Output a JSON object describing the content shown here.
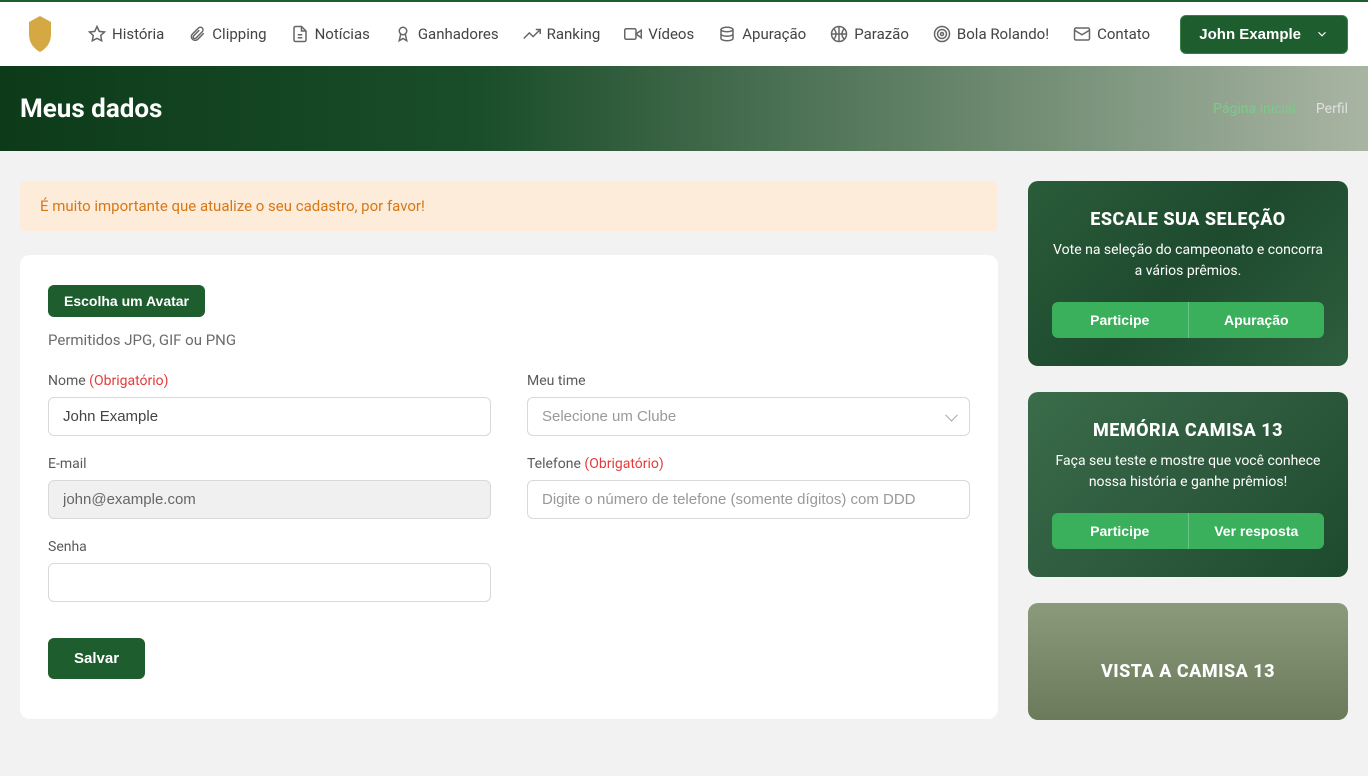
{
  "nav": {
    "items": [
      {
        "label": "História",
        "icon": "star"
      },
      {
        "label": "Clipping",
        "icon": "paperclip"
      },
      {
        "label": "Notícias",
        "icon": "file"
      },
      {
        "label": "Ganhadores",
        "icon": "award"
      },
      {
        "label": "Ranking",
        "icon": "trending"
      },
      {
        "label": "Vídeos",
        "icon": "video"
      },
      {
        "label": "Apuração",
        "icon": "layers"
      },
      {
        "label": "Parazão",
        "icon": "basketball"
      },
      {
        "label": "Bola Rolando!",
        "icon": "target"
      },
      {
        "label": "Contato",
        "icon": "mail"
      }
    ],
    "user": "John Example"
  },
  "hero": {
    "title": "Meus dados",
    "breadcrumb": [
      "Página inicial",
      "Perfil"
    ]
  },
  "alert": "É muito importante que atualize o seu cadastro, por favor!",
  "form": {
    "avatar_btn": "Escolha um Avatar",
    "avatar_hint": "Permitidos JPG, GIF ou PNG",
    "required": "(Obrigatório)",
    "name_label": "Nome",
    "name_value": "John Example",
    "team_label": "Meu time",
    "team_placeholder": "Selecione um Clube",
    "email_label": "E-mail",
    "email_value": "john@example.com",
    "phone_label": "Telefone",
    "phone_placeholder": "Digite o número de telefone (somente dígitos) com DDD",
    "password_label": "Senha",
    "save": "Salvar"
  },
  "sidebar": {
    "cards": [
      {
        "title": "ESCALE SUA SELEÇÃO",
        "desc": "Vote na seleção do campeonato e concorra a vários prêmios.",
        "btn1": "Participe",
        "btn2": "Apuração"
      },
      {
        "title": "MEMÓRIA CAMISA 13",
        "desc": "Faça seu teste e mostre que você conhece nossa história e ganhe prêmios!",
        "btn1": "Participe",
        "btn2": "Ver resposta"
      },
      {
        "title": "VISTA A CAMISA 13",
        "desc": "",
        "btn1": "",
        "btn2": ""
      }
    ]
  }
}
